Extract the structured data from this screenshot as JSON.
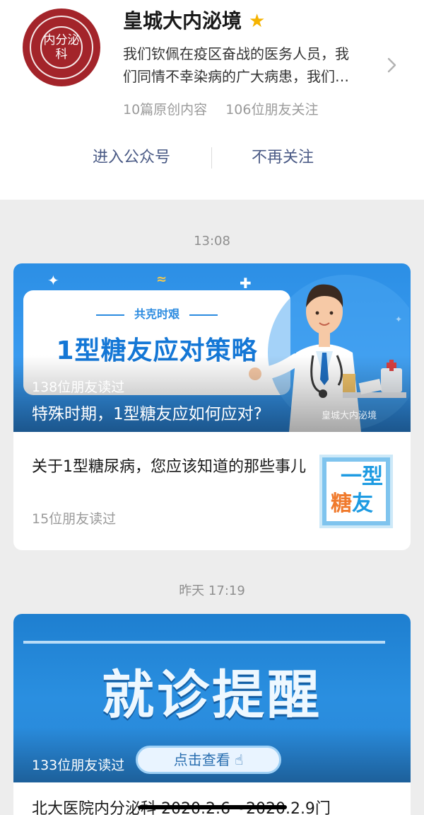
{
  "header": {
    "logo_text": "内分泌科",
    "title": "皇城大内泌境",
    "desc_line1": "我们钦佩在疫区奋战的医务人员，我",
    "desc_line2": "们同情不幸染病的广大病患，我们…",
    "stats": {
      "original": "10篇原创内容",
      "followers": "106位朋友关注"
    },
    "buttons": {
      "enter": "进入公众号",
      "unfollow": "不再关注"
    }
  },
  "feed": [
    {
      "time": "13:08",
      "hero": {
        "subheading": "共克时艰",
        "heading": "1型糖友应对策略",
        "reads": "138位朋友读过",
        "title": "特殊时期，1型糖友应如何应对?",
        "watermark": "皇城大内泌境"
      },
      "item": {
        "title": "关于1型糖尿病，您应该知道的那些事儿",
        "reads": "15位朋友读过",
        "thumb_line1": "一型",
        "thumb_line2a": "糖",
        "thumb_line2b": "友"
      }
    },
    {
      "time": "昨天 17:19",
      "hero": {
        "heading": "就诊提醒",
        "pill": "点击查看",
        "reads": "133位朋友读过"
      },
      "item": {
        "title": "北大医院内分泌科 2020.2.6～2020.2.9门"
      }
    }
  ],
  "colors": {
    "accent": "#4a5a85",
    "logo": "#a3242a",
    "star": "#f5b300",
    "hero_blue": "#2c8fe5"
  }
}
